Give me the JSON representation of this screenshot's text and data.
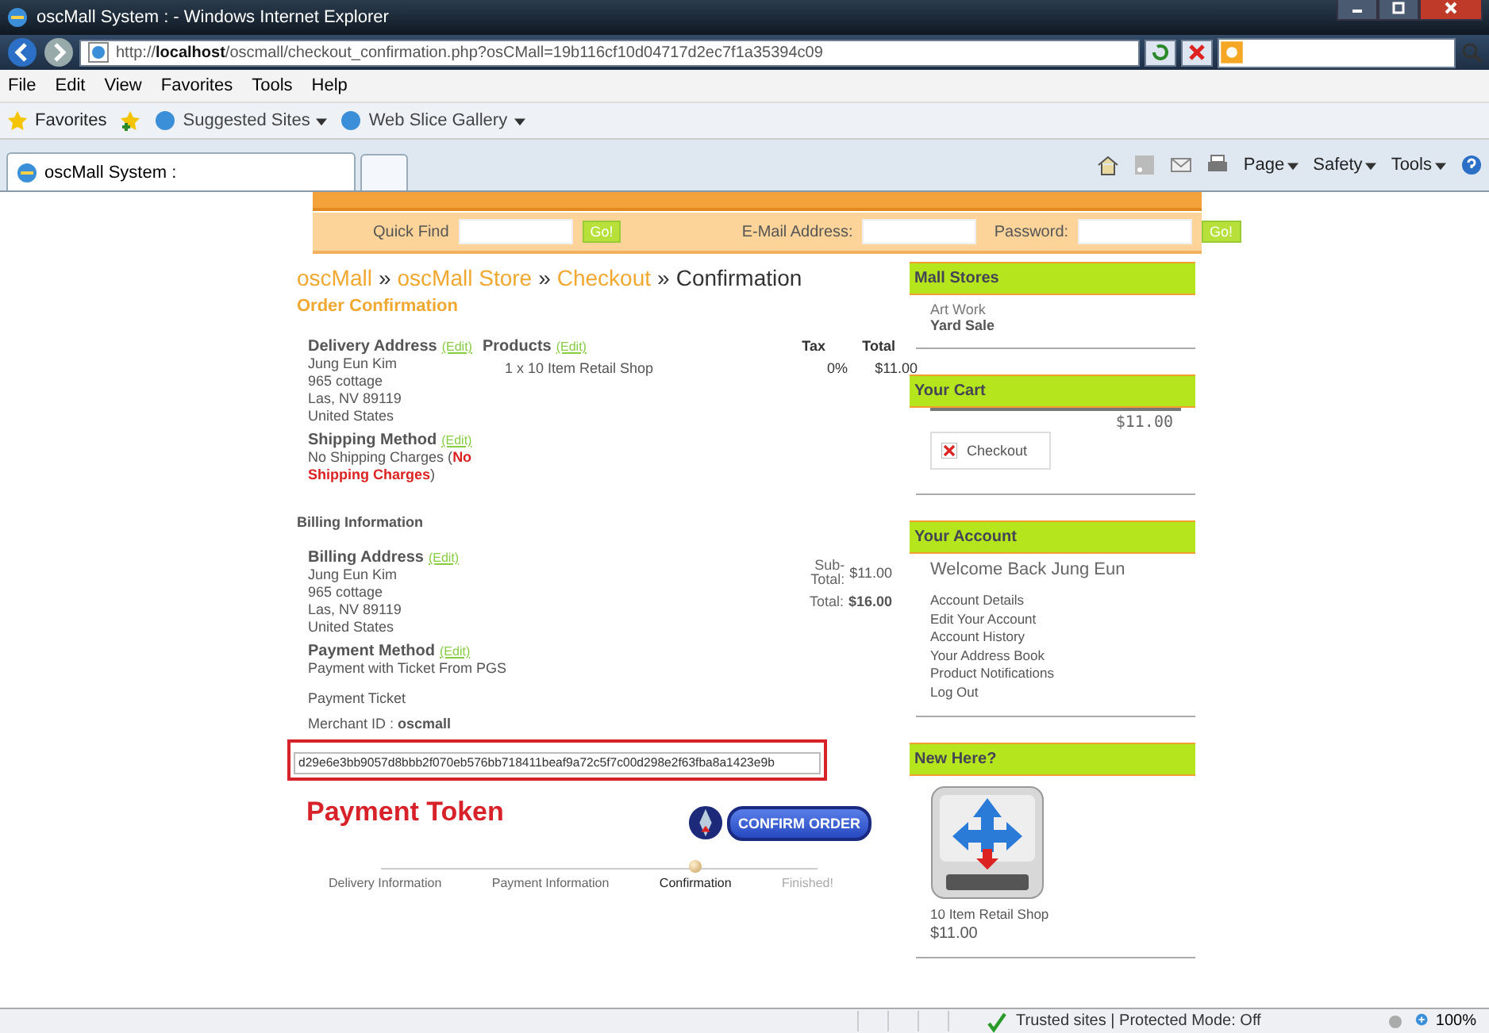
{
  "window": {
    "title": "oscMall System : - Windows Internet Explorer"
  },
  "address_bar": {
    "url": "http://**localhost**/oscmall/checkout_confirmation.php?osCMall=19b116cf10d04717d2ec7f1a35394c09"
  },
  "menu": [
    "File",
    "Edit",
    "View",
    "Favorites",
    "Tools",
    "Help"
  ],
  "favorites_bar": {
    "favorites": "Favorites",
    "links": [
      {
        "label": "Suggested Sites"
      },
      {
        "label": "Web Slice Gallery"
      }
    ]
  },
  "tab": {
    "label": "oscMall System :"
  },
  "command_bar": [
    "Page",
    "Safety",
    "Tools"
  ],
  "search_bar": {
    "quick_find": "Quick Find",
    "go": "Go!",
    "email": "E-Mail Address:",
    "password": "Password:",
    "go_2": "Go!"
  },
  "breadcrumb": [
    {
      "label": "oscMall",
      "link": true,
      "separator": "»"
    },
    {
      "label": "oscMall Store",
      "link": true,
      "separator": "»"
    },
    {
      "label": "Checkout",
      "link": true,
      "separator": "»"
    },
    {
      "label": "Confirmation",
      "link": false
    }
  ],
  "heading": "Order Confirmation",
  "delivery": {
    "title": "Delivery Address",
    "edit": "(Edit)",
    "lines": [
      "Jung Eun Kim",
      "965 cottage",
      "Las, NV 89119",
      "United States"
    ]
  },
  "shipping": {
    "title": "Shipping Method",
    "edit": "(Edit)",
    "text": "No Shipping Charges (",
    "highlight": "No Shipping Charges",
    "close": ")"
  },
  "products": {
    "title": "Products",
    "edit": "(Edit)",
    "tax_header": "Tax",
    "total_header": "Total",
    "rows": [
      {
        "name": "1 x 10 Item Retail Shop",
        "tax": "0%",
        "total": "$11.00"
      }
    ]
  },
  "billing_heading": "Billing Information",
  "billing": {
    "title": "Billing Address",
    "edit": "(Edit)",
    "lines": [
      "Jung Eun Kim",
      "965 cottage",
      "Las, NV 89119",
      "United States"
    ]
  },
  "payment": {
    "title": "Payment Method",
    "edit": "(Edit)",
    "text": "Payment with Ticket From PGS",
    "ticket": "Payment Ticket",
    "merchant": "Merchant ID : **oscmall**"
  },
  "totals": [
    {
      "label": "Sub-Total:",
      "value": "$11.00",
      "bold": false
    },
    {
      "label": "Total:",
      "value": "$16.00",
      "bold": true
    }
  ],
  "token": {
    "value": "d29e6e3bb9057d8bbb2f070eb576bb718411beaf9a72c5f7c00d298e2f63fba8a1423e9b",
    "label": "Payment Token"
  },
  "confirm_button": "CONFIRM ORDER",
  "steps": [
    {
      "label": "Delivery Information",
      "selected": false,
      "completed": true
    },
    {
      "label": "Payment Information",
      "selected": false,
      "completed": true
    },
    {
      "label": "Confirmation",
      "selected": true,
      "completed": false
    },
    {
      "label": "Finished!",
      "selected": false,
      "completed": false
    }
  ],
  "sidebar": {
    "mall_stores": {
      "title": "Mall Stores",
      "items": [
        {
          "label": "Art Work",
          "bold": false
        },
        {
          "label": "Yard Sale",
          "bold": true
        }
      ]
    },
    "cart": {
      "title": "Your Cart",
      "total": "$11.00",
      "checkout": "Checkout"
    },
    "account": {
      "title": "Your Account",
      "welcome": "Welcome Back Jung Eun",
      "links": [
        "Account Details",
        "Edit Your Account",
        "Account History",
        "Your Address Book",
        "Product Notifications",
        "Log Out"
      ]
    },
    "new_here": {
      "title": "New Here?",
      "product": "10 Item Retail Shop",
      "price": "$11.00"
    }
  },
  "status_bar": {
    "zone": "Trusted sites | Protected Mode: Off",
    "zoom": "100%"
  }
}
